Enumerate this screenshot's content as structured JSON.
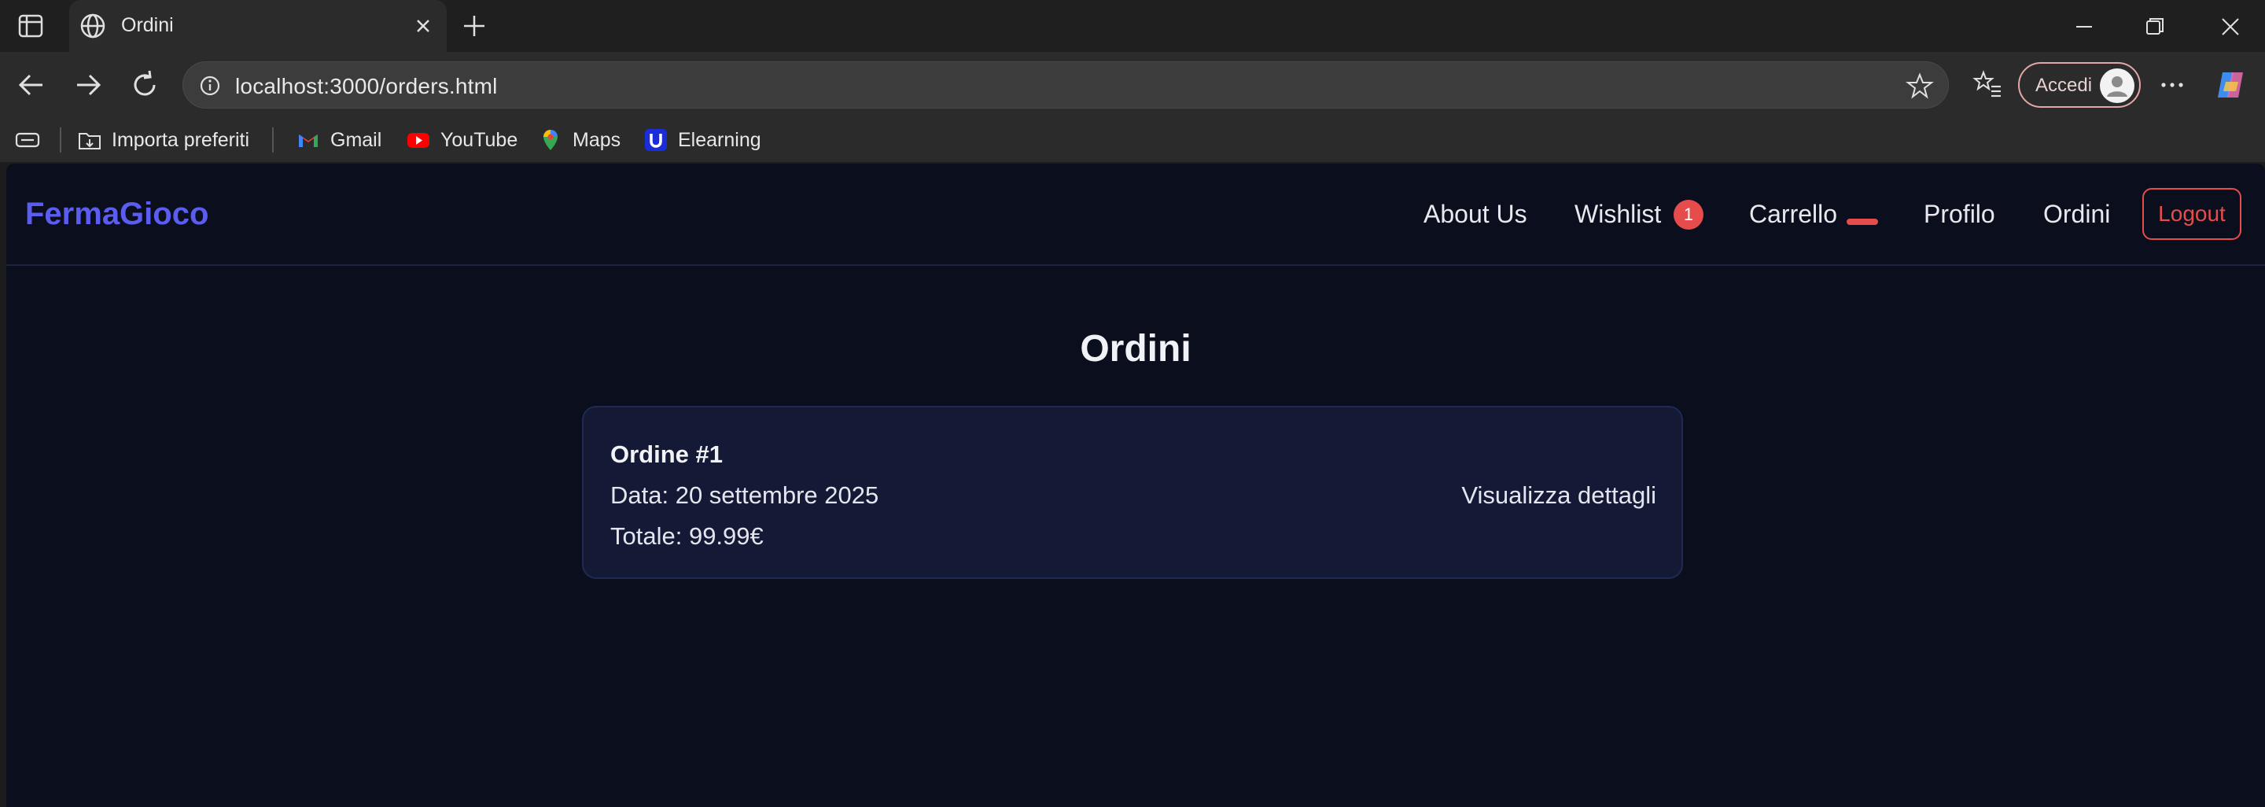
{
  "browser": {
    "tab_title": "Ordini",
    "url": "localhost:3000/orders.html",
    "signin_label": "Accedi",
    "bookmarks": [
      {
        "label": "Importa preferiti",
        "icon": "import-folder-icon"
      },
      {
        "label": "Gmail",
        "icon": "gmail-icon"
      },
      {
        "label": "YouTube",
        "icon": "youtube-icon"
      },
      {
        "label": "Maps",
        "icon": "maps-icon"
      },
      {
        "label": "Elearning",
        "icon": "elearning-icon"
      }
    ]
  },
  "site": {
    "brand": "FermaGioco",
    "nav": {
      "about": "About Us",
      "wishlist": "Wishlist",
      "wishlist_count": "1",
      "cart": "Carrello",
      "profile": "Profilo",
      "orders": "Ordini",
      "logout": "Logout"
    },
    "accent_color": "#5b5cf0",
    "danger_color": "#e74c4c"
  },
  "main": {
    "title": "Ordini",
    "orders": [
      {
        "title": "Ordine #1",
        "date": "Data: 20 settembre 2025",
        "total": "Totale: 99.99€",
        "details_label": "Visualizza dettagli"
      }
    ]
  }
}
